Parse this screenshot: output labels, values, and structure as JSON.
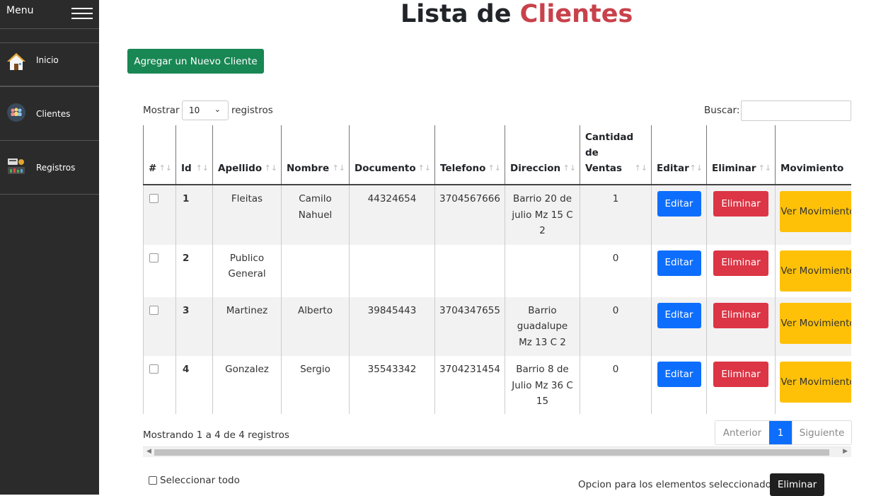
{
  "sidebar": {
    "menu_label": "Menu",
    "items": [
      {
        "label": "Inicio",
        "icon": "home-icon"
      },
      {
        "label": "Clientes",
        "icon": "clients-icon"
      },
      {
        "label": "Registros",
        "icon": "registers-icon"
      }
    ]
  },
  "page": {
    "title_part1": "Lista de",
    "title_part2": "Clientes",
    "add_button": "Agregar un Nuevo Cliente"
  },
  "datatable": {
    "show_label": "Mostrar",
    "show_value": "10",
    "records_label": "registros",
    "search_label": "Buscar:",
    "columns": [
      "#",
      "Id",
      "Apellido",
      "Nombre",
      "Documento",
      "Telefono",
      "Direccion",
      "Cantidad de Ventas",
      "Editar",
      "Eliminar",
      "Movimiento"
    ],
    "rows": [
      {
        "id": "1",
        "apellido": "Fleitas",
        "nombre": "Camilo Nahuel",
        "documento": "44324654",
        "telefono": "3704567666",
        "direccion": "Barrio 20 de julio Mz 15 C 2",
        "ventas": "1"
      },
      {
        "id": "2",
        "apellido": "Publico General",
        "nombre": "",
        "documento": "",
        "telefono": "",
        "direccion": "",
        "ventas": "0"
      },
      {
        "id": "3",
        "apellido": "Martinez",
        "nombre": "Alberto",
        "documento": "39845443",
        "telefono": "3704347655",
        "direccion": "Barrio guadalupe Mz 13 C 2",
        "ventas": "0"
      },
      {
        "id": "4",
        "apellido": "Gonzalez",
        "nombre": "Sergio",
        "documento": "35543342",
        "telefono": "3704231454",
        "direccion": "Barrio 8 de Julio Mz 36 C 15",
        "ventas": "0"
      }
    ],
    "edit_label": "Editar",
    "delete_label": "Eliminar",
    "movement_label": "Ver Movimiento",
    "info": "Mostrando 1 a 4 de 4 registros",
    "pager": {
      "prev": "Anterior",
      "current": "1",
      "next": "Siguiente"
    }
  },
  "footer": {
    "select_all": "Seleccionar todo",
    "options_label": "Opcion para los elementos seleccionados",
    "bulk_delete": "Eliminar"
  },
  "colors": {
    "add": "#198754",
    "edit": "#0d6efd",
    "delete": "#dc3545",
    "movement": "#ffc107",
    "accent": "#c8424b",
    "sidebar": "#2b2b2b"
  }
}
